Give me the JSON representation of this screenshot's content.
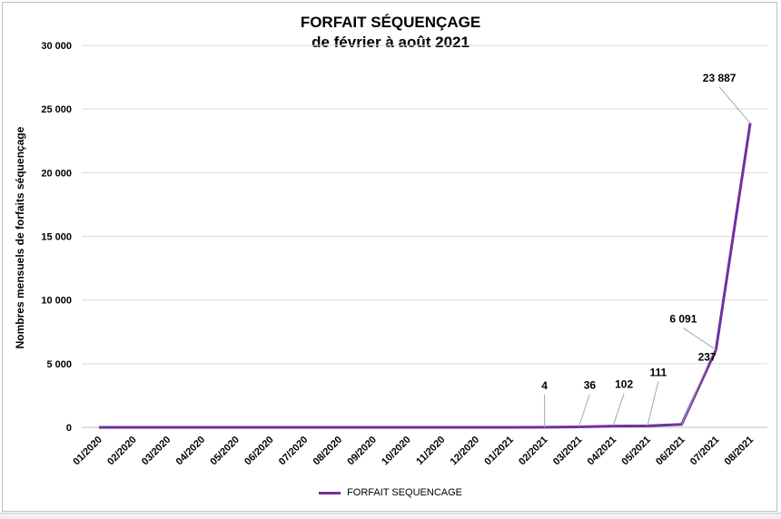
{
  "chart_data": {
    "type": "line",
    "title": "FORFAIT SÉQUENÇAGE",
    "subtitle": "de février à août 2021",
    "ylabel": "Nombres mensuels de forfaits séquençage",
    "xlabel": "",
    "ylim": [
      0,
      30000
    ],
    "yticks": [
      0,
      5000,
      10000,
      15000,
      20000,
      25000,
      30000
    ],
    "ytick_labels": [
      "0",
      "5 000",
      "10 000",
      "15 000",
      "20 000",
      "25 000",
      "30 000"
    ],
    "grid": true,
    "legend_position": "bottom",
    "categories": [
      "01/2020",
      "02/2020",
      "03/2020",
      "04/2020",
      "05/2020",
      "06/2020",
      "07/2020",
      "08/2020",
      "09/2020",
      "10/2020",
      "11/2020",
      "12/2020",
      "01/2021",
      "02/2021",
      "03/2021",
      "04/2021",
      "05/2021",
      "06/2021",
      "07/2021",
      "08/2021"
    ],
    "series": [
      {
        "name": "FORFAIT SEQUENCAGE",
        "color": "#7030A0",
        "values": [
          0,
          0,
          0,
          0,
          0,
          0,
          0,
          0,
          0,
          0,
          0,
          0,
          0,
          4,
          36,
          102,
          111,
          237,
          6091,
          23887
        ],
        "data_labels": [
          "",
          "",
          "",
          "",
          "",
          "",
          "",
          "",
          "",
          "",
          "",
          "",
          "",
          "4",
          "36",
          "102",
          "111",
          "237",
          "6 091",
          "23 887"
        ]
      }
    ]
  }
}
